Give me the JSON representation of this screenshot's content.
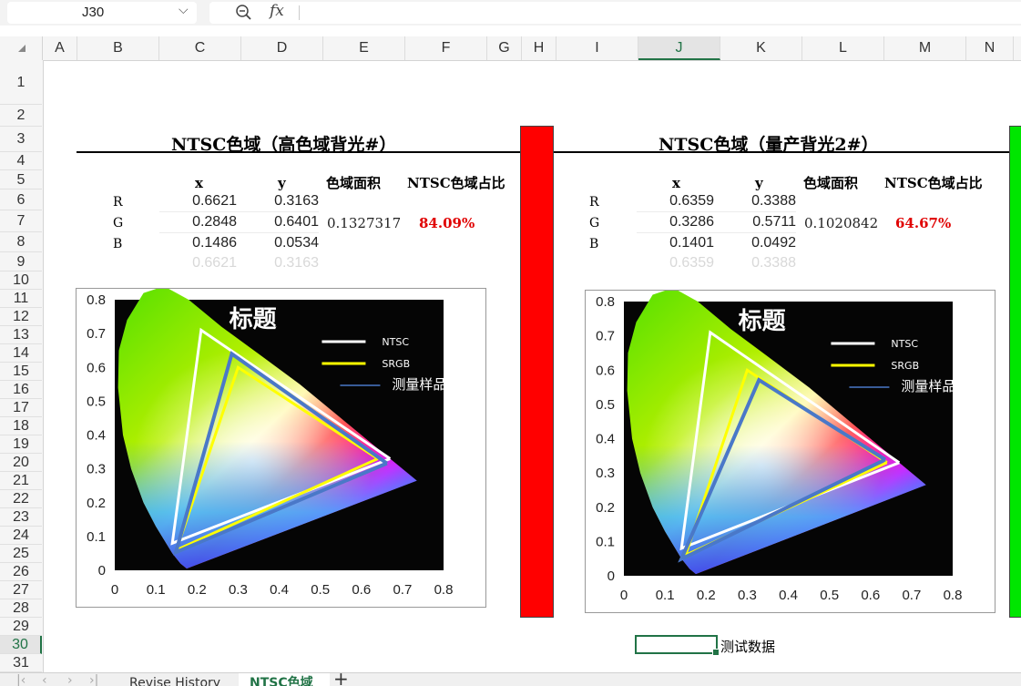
{
  "formula_bar": {
    "cell_ref": "J30",
    "fx": "fx",
    "chevron": "⌵"
  },
  "columns": [
    {
      "label": "A",
      "w": 38
    },
    {
      "label": "B",
      "w": 90
    },
    {
      "label": "C",
      "w": 90
    },
    {
      "label": "D",
      "w": 90
    },
    {
      "label": "E",
      "w": 90
    },
    {
      "label": "F",
      "w": 90
    },
    {
      "label": "G",
      "w": 38
    },
    {
      "label": "H",
      "w": 38
    },
    {
      "label": "I",
      "w": 90
    },
    {
      "label": "J",
      "w": 90,
      "selected": true
    },
    {
      "label": "K",
      "w": 90
    },
    {
      "label": "L",
      "w": 90
    },
    {
      "label": "M",
      "w": 90
    },
    {
      "label": "N",
      "w": 52
    }
  ],
  "rows": [
    "1",
    "2",
    "3",
    "4",
    "5",
    "6",
    "7",
    "8",
    "9",
    "10",
    "11",
    "12",
    "13",
    "14",
    "15",
    "16",
    "17",
    "18",
    "19",
    "20",
    "21",
    "22",
    "23",
    "24",
    "25",
    "26",
    "27",
    "28",
    "29",
    "30",
    "31"
  ],
  "selected_row": "30",
  "tables": [
    {
      "title": "NTSC色域（高色域背光#）",
      "headers": {
        "x": "x",
        "y": "y",
        "area": "色域面积",
        "ratio": "NTSC色域占比"
      },
      "rows": [
        {
          "label": "R",
          "x": "0.6621",
          "y": "0.3163"
        },
        {
          "label": "G",
          "x": "0.2848",
          "y": "0.6401"
        },
        {
          "label": "B",
          "x": "0.1486",
          "y": "0.0534"
        }
      ],
      "repeat": {
        "x": "0.6621",
        "y": "0.3163"
      },
      "area": "0.1327317",
      "ratio": "84.09%",
      "bar_color": "#ff0000"
    },
    {
      "title": "NTSC色域（量产背光2#）",
      "headers": {
        "x": "x",
        "y": "y",
        "area": "色域面积",
        "ratio": "NTSC色域占比"
      },
      "rows": [
        {
          "label": "R",
          "x": "0.6359",
          "y": "0.3388"
        },
        {
          "label": "G",
          "x": "0.3286",
          "y": "0.5711"
        },
        {
          "label": "B",
          "x": "0.1401",
          "y": "0.0492"
        }
      ],
      "repeat": {
        "x": "0.6359",
        "y": "0.3388"
      },
      "area": "0.1020842",
      "ratio": "64.67%",
      "bar_color": "#00e600"
    }
  ],
  "chart_data": [
    {
      "type": "scatter",
      "title": "标题",
      "xlim": [
        0,
        0.8
      ],
      "ylim": [
        0,
        0.8
      ],
      "x_ticks": [
        "0",
        "0.1",
        "0.2",
        "0.3",
        "0.4",
        "0.5",
        "0.6",
        "0.7",
        "0.8"
      ],
      "y_ticks": [
        "0",
        "0.1",
        "0.2",
        "0.3",
        "0.4",
        "0.5",
        "0.6",
        "0.7",
        "0.8"
      ],
      "legend": [
        "NTSC",
        "SRGB",
        "测量样品"
      ],
      "legend_position": "top-right",
      "series": [
        {
          "name": "NTSC",
          "color": "#ffffff",
          "points": [
            [
              0.67,
              0.33
            ],
            [
              0.21,
              0.71
            ],
            [
              0.14,
              0.08
            ],
            [
              0.67,
              0.33
            ]
          ]
        },
        {
          "name": "SRGB",
          "color": "#ffff00",
          "points": [
            [
              0.64,
              0.33
            ],
            [
              0.3,
              0.6
            ],
            [
              0.15,
              0.06
            ],
            [
              0.64,
              0.33
            ]
          ]
        },
        {
          "name": "测量样品",
          "color": "#4a78c8",
          "points": [
            [
              0.6621,
              0.3163
            ],
            [
              0.2848,
              0.6401
            ],
            [
              0.1486,
              0.0534
            ],
            [
              0.6621,
              0.3163
            ]
          ]
        }
      ]
    },
    {
      "type": "scatter",
      "title": "标题",
      "xlim": [
        0,
        0.8
      ],
      "ylim": [
        0,
        0.8
      ],
      "x_ticks": [
        "0",
        "0.1",
        "0.2",
        "0.3",
        "0.4",
        "0.5",
        "0.6",
        "0.7",
        "0.8"
      ],
      "y_ticks": [
        "0",
        "0.1",
        "0.2",
        "0.3",
        "0.4",
        "0.5",
        "0.6",
        "0.7",
        "0.8"
      ],
      "legend": [
        "NTSC",
        "SRGB",
        "测量样品"
      ],
      "legend_position": "top-right",
      "series": [
        {
          "name": "NTSC",
          "color": "#ffffff",
          "points": [
            [
              0.67,
              0.33
            ],
            [
              0.21,
              0.71
            ],
            [
              0.14,
              0.08
            ],
            [
              0.67,
              0.33
            ]
          ]
        },
        {
          "name": "SRGB",
          "color": "#ffff00",
          "points": [
            [
              0.64,
              0.33
            ],
            [
              0.3,
              0.6
            ],
            [
              0.15,
              0.06
            ],
            [
              0.64,
              0.33
            ]
          ]
        },
        {
          "name": "测量样品",
          "color": "#4a78c8",
          "points": [
            [
              0.6359,
              0.3388
            ],
            [
              0.3286,
              0.5711
            ],
            [
              0.1401,
              0.0492
            ],
            [
              0.6359,
              0.3388
            ]
          ]
        }
      ]
    }
  ],
  "note": "测试数据",
  "sheet_tabs": {
    "nav": [
      "|‹",
      "‹",
      "›",
      "›|"
    ],
    "tabs": [
      {
        "label": "Revise History"
      },
      {
        "label": "NTSC色域",
        "active": true
      }
    ],
    "add": "+"
  }
}
